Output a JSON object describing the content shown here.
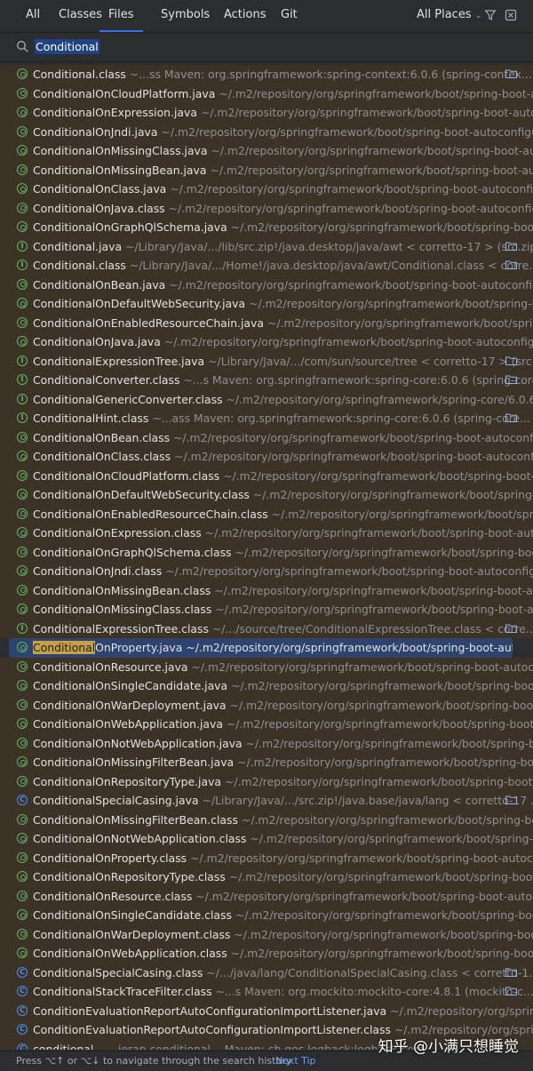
{
  "tabs": [
    {
      "label": "All",
      "active": false
    },
    {
      "label": "Classes",
      "active": false
    },
    {
      "label": "Files",
      "active": true
    },
    {
      "label": "Symbols",
      "active": false
    },
    {
      "label": "Actions",
      "active": false
    },
    {
      "label": "Git",
      "active": false
    }
  ],
  "scope": {
    "label": "All Places"
  },
  "search": {
    "query": "Conditional"
  },
  "highlight": "Conditional",
  "rows": [
    {
      "icon": "anno",
      "name": "Conditional.class",
      "path": "~...ss      Maven: org.springframework:spring-context:6.0.6 (spring-contex...",
      "folder": true
    },
    {
      "icon": "anno",
      "name": "ConditionalOnCloudPlatform.java",
      "path": "~/.m2/repository/org/springframework/boot/spring-boot-autoc",
      "folder": false
    },
    {
      "icon": "anno",
      "name": "ConditionalOnExpression.java",
      "path": "~/.m2/repository/org/springframework/boot/spring-boot-autoconf",
      "folder": false
    },
    {
      "icon": "anno",
      "name": "ConditionalOnJndi.java",
      "path": "~/.m2/repository/org/springframework/boot/spring-boot-autoconfigure/3",
      "folder": false
    },
    {
      "icon": "anno",
      "name": "ConditionalOnMissingClass.java",
      "path": "~/.m2/repository/org/springframework/boot/spring-boot-autoco",
      "folder": false
    },
    {
      "icon": "anno",
      "name": "ConditionalOnMissingBean.java",
      "path": "~/.m2/repository/org/springframework/boot/spring-boot-autoco",
      "folder": false
    },
    {
      "icon": "anno",
      "name": "ConditionalOnClass.java",
      "path": "~/.m2/repository/org/springframework/boot/spring-boot-autoconfigure/",
      "folder": false
    },
    {
      "icon": "anno",
      "name": "ConditionalOnJava.class",
      "path": "~/.m2/repository/org/springframework/boot/spring-boot-autoconfigure/",
      "folder": false
    },
    {
      "icon": "anno",
      "name": "ConditionalOnGraphQlSchema.java",
      "path": "~/.m2/repository/org/springframework/boot/spring-boot-aut",
      "folder": false
    },
    {
      "icon": "iface",
      "name": "Conditional.java",
      "path": "~/Library/Java/.../lib/src.zip!/java.desktop/java/awt      < corretto-17 > (src.zip)",
      "folder": true
    },
    {
      "icon": "iface",
      "name": "Conditional.class",
      "path": "~/Library/Java/.../Home!/java.desktop/java/awt/Conditional.class      < corre...",
      "folder": true
    },
    {
      "icon": "anno",
      "name": "ConditionalOnBean.java",
      "path": "~/.m2/repository/org/springframework/boot/spring-boot-autoconfigure/",
      "folder": false
    },
    {
      "icon": "anno",
      "name": "ConditionalOnDefaultWebSecurity.java",
      "path": "~/.m2/repository/org/springframework/boot/spring-boot",
      "folder": false
    },
    {
      "icon": "anno",
      "name": "ConditionalOnEnabledResourceChain.java",
      "path": "~/.m2/repository/org/springframework/boot/spring-bo",
      "folder": false
    },
    {
      "icon": "anno",
      "name": "ConditionalOnJava.java",
      "path": "~/.m2/repository/org/springframework/boot/spring-boot-autoconfigure/3",
      "folder": false
    },
    {
      "icon": "iface",
      "name": "ConditionalExpressionTree.java",
      "path": "~/Library/Java/.../com/sun/source/tree      < corretto-17 > (src.zip)",
      "folder": true
    },
    {
      "icon": "iface",
      "name": "ConditionalConverter.class",
      "path": "~...s      Maven: org.springframework:spring-core:6.0.6 (spring-core...",
      "folder": true
    },
    {
      "icon": "iface",
      "name": "ConditionalGenericConverter.class",
      "path": "~/.m2/repository/org/springframework/spring-core/6.0.6/spri",
      "folder": false
    },
    {
      "icon": "iface",
      "name": "ConditionalHint.class",
      "path": "~...ass      Maven: org.springframework:spring-core:6.0.6 (spring-core...",
      "folder": true
    },
    {
      "icon": "anno",
      "name": "ConditionalOnBean.class",
      "path": "~/.m2/repository/org/springframework/boot/spring-boot-autoconfigure",
      "folder": false
    },
    {
      "icon": "anno",
      "name": "ConditionalOnClass.class",
      "path": "~/.m2/repository/org/springframework/boot/spring-boot-autoconfigure",
      "folder": false
    },
    {
      "icon": "anno",
      "name": "ConditionalOnCloudPlatform.class",
      "path": "~/.m2/repository/org/springframework/boot/spring-boot-auto",
      "folder": false
    },
    {
      "icon": "anno",
      "name": "ConditionalOnDefaultWebSecurity.class",
      "path": "~/.m2/repository/org/springframework/boot/spring-boot",
      "folder": false
    },
    {
      "icon": "anno",
      "name": "ConditionalOnEnabledResourceChain.class",
      "path": "~/.m2/repository/org/springframework/boot/spring-b",
      "folder": false
    },
    {
      "icon": "anno",
      "name": "ConditionalOnExpression.class",
      "path": "~/.m2/repository/org/springframework/boot/spring-boot-autocon",
      "folder": false
    },
    {
      "icon": "anno",
      "name": "ConditionalOnGraphQlSchema.class",
      "path": "~/.m2/repository/org/springframework/boot/spring-boot-aut",
      "folder": false
    },
    {
      "icon": "anno",
      "name": "ConditionalOnJndi.class",
      "path": "~/.m2/repository/org/springframework/boot/spring-boot-autoconfigure/",
      "folder": false
    },
    {
      "icon": "anno",
      "name": "ConditionalOnMissingBean.class",
      "path": "~/.m2/repository/org/springframework/boot/spring-boot-autoc",
      "folder": false
    },
    {
      "icon": "anno",
      "name": "ConditionalOnMissingClass.class",
      "path": "~/.m2/repository/org/springframework/boot/spring-boot-autoc",
      "folder": false
    },
    {
      "icon": "iface",
      "name": "ConditionalExpressionTree.class",
      "path": "~/.../source/tree/ConditionalExpressionTree.class      < corre...",
      "folder": true
    },
    {
      "icon": "anno",
      "name": "ConditionalOnProperty.java",
      "path": "~/.m2/repository/org/springframework/boot/spring-boot-autoconfigu",
      "folder": false,
      "selected": true
    },
    {
      "icon": "anno",
      "name": "ConditionalOnResource.java",
      "path": "~/.m2/repository/org/springframework/boot/spring-boot-autoconfig",
      "folder": false
    },
    {
      "icon": "anno",
      "name": "ConditionalOnSingleCandidate.java",
      "path": "~/.m2/repository/org/springframework/boot/spring-boot-auto",
      "folder": false
    },
    {
      "icon": "anno",
      "name": "ConditionalOnWarDeployment.java",
      "path": "~/.m2/repository/org/springframework/boot/spring-boot-auto",
      "folder": false
    },
    {
      "icon": "anno",
      "name": "ConditionalOnWebApplication.java",
      "path": "~/.m2/repository/org/springframework/boot/spring-boot-auto",
      "folder": false
    },
    {
      "icon": "anno",
      "name": "ConditionalOnNotWebApplication.java",
      "path": "~/.m2/repository/org/springframework/boot/spring-boot-a",
      "folder": false
    },
    {
      "icon": "anno",
      "name": "ConditionalOnMissingFilterBean.java",
      "path": "~/.m2/repository/org/springframework/boot/spring-boot-aut",
      "folder": false
    },
    {
      "icon": "anno",
      "name": "ConditionalOnRepositoryType.java",
      "path": "~/.m2/repository/org/springframework/boot/spring-boot-aut",
      "folder": false
    },
    {
      "icon": "cls",
      "name": "ConditionalSpecialCasing.java",
      "path": "~/Library/Java/.../src.zip!/java.base/java/lang      < corretto-17 ...",
      "folder": true
    },
    {
      "icon": "anno",
      "name": "ConditionalOnMissingFilterBean.class",
      "path": "~/.m2/repository/org/springframework/boot/spring-boot-a",
      "folder": false
    },
    {
      "icon": "anno",
      "name": "ConditionalOnNotWebApplication.class",
      "path": "~/.m2/repository/org/springframework/boot/spring-boot-",
      "folder": false
    },
    {
      "icon": "anno",
      "name": "ConditionalOnProperty.class",
      "path": "~/.m2/repository/org/springframework/boot/spring-boot-autoconfig",
      "folder": false
    },
    {
      "icon": "anno",
      "name": "ConditionalOnRepositoryType.class",
      "path": "~/.m2/repository/org/springframework/boot/spring-boot-aut",
      "folder": false
    },
    {
      "icon": "anno",
      "name": "ConditionalOnResource.class",
      "path": "~/.m2/repository/org/springframework/boot/spring-boot-autoconfi",
      "folder": false
    },
    {
      "icon": "anno",
      "name": "ConditionalOnSingleCandidate.class",
      "path": "~/.m2/repository/org/springframework/boot/spring-boot-aut",
      "folder": false
    },
    {
      "icon": "anno",
      "name": "ConditionalOnWarDeployment.class",
      "path": "~/.m2/repository/org/springframework/boot/spring-boot-aut",
      "folder": false
    },
    {
      "icon": "anno",
      "name": "ConditionalOnWebApplication.class",
      "path": "~/.m2/repository/org/springframework/boot/spring-boot-aut",
      "folder": false
    },
    {
      "icon": "cls",
      "name": "ConditionalSpecialCasing.class",
      "path": "~/.../java/lang/ConditionalSpecialCasing.class      < corretto-1...",
      "folder": true
    },
    {
      "icon": "cls",
      "name": "ConditionalStackTraceFilter.class",
      "path": "~...s      Maven: org.mockito:mockito-core:4.8.1 (mockito-c...",
      "folder": true
    },
    {
      "icon": "cls",
      "name": "ConditionEvaluationReportAutoConfigurationImportListener.java",
      "path": "~/.m2/repository/org/springfram",
      "folder": false
    },
    {
      "icon": "cls",
      "name": "ConditionEvaluationReportAutoConfigurationImportListener.class",
      "path": "~/.m2/repository/org/springfram",
      "folder": false
    },
    {
      "icon": "cls",
      "name": "conditional...",
      "path": "...jerap.conditional...      Maven: ch.qos.logback:logback-core...",
      "folder": false
    }
  ],
  "footer": {
    "hint": "Press ⌥↑ or ⌥↓ to navigate through the search history",
    "next_tip": "Next Tip"
  },
  "watermark": "知乎 @小满只想睡觉",
  "colors": {
    "accent": "#3574f0",
    "row_bg": "#3c3326",
    "selected_bg": "#2e436e",
    "match_highlight": "#c6a046"
  }
}
